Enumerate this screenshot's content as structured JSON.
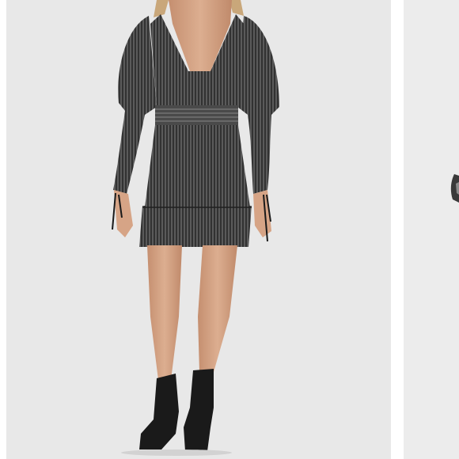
{
  "gallery": {
    "images": [
      {
        "subject": "model-wearing-metallic-silver-black-long-sleeve-mini-dress-with-black-ankle-boots",
        "background_color": "#e8e8e8"
      },
      {
        "subject": "partial-next-product-image",
        "background_color": "#ececec"
      }
    ]
  },
  "colors": {
    "page_background": "#ffffff",
    "dress_dark": "#2f2f2f",
    "dress_mid": "#5a5a5a",
    "dress_highlight": "#9a9a9a",
    "skin": "#d9a98a",
    "boots": "#1a1a1a",
    "hair": "#c9a77a"
  }
}
